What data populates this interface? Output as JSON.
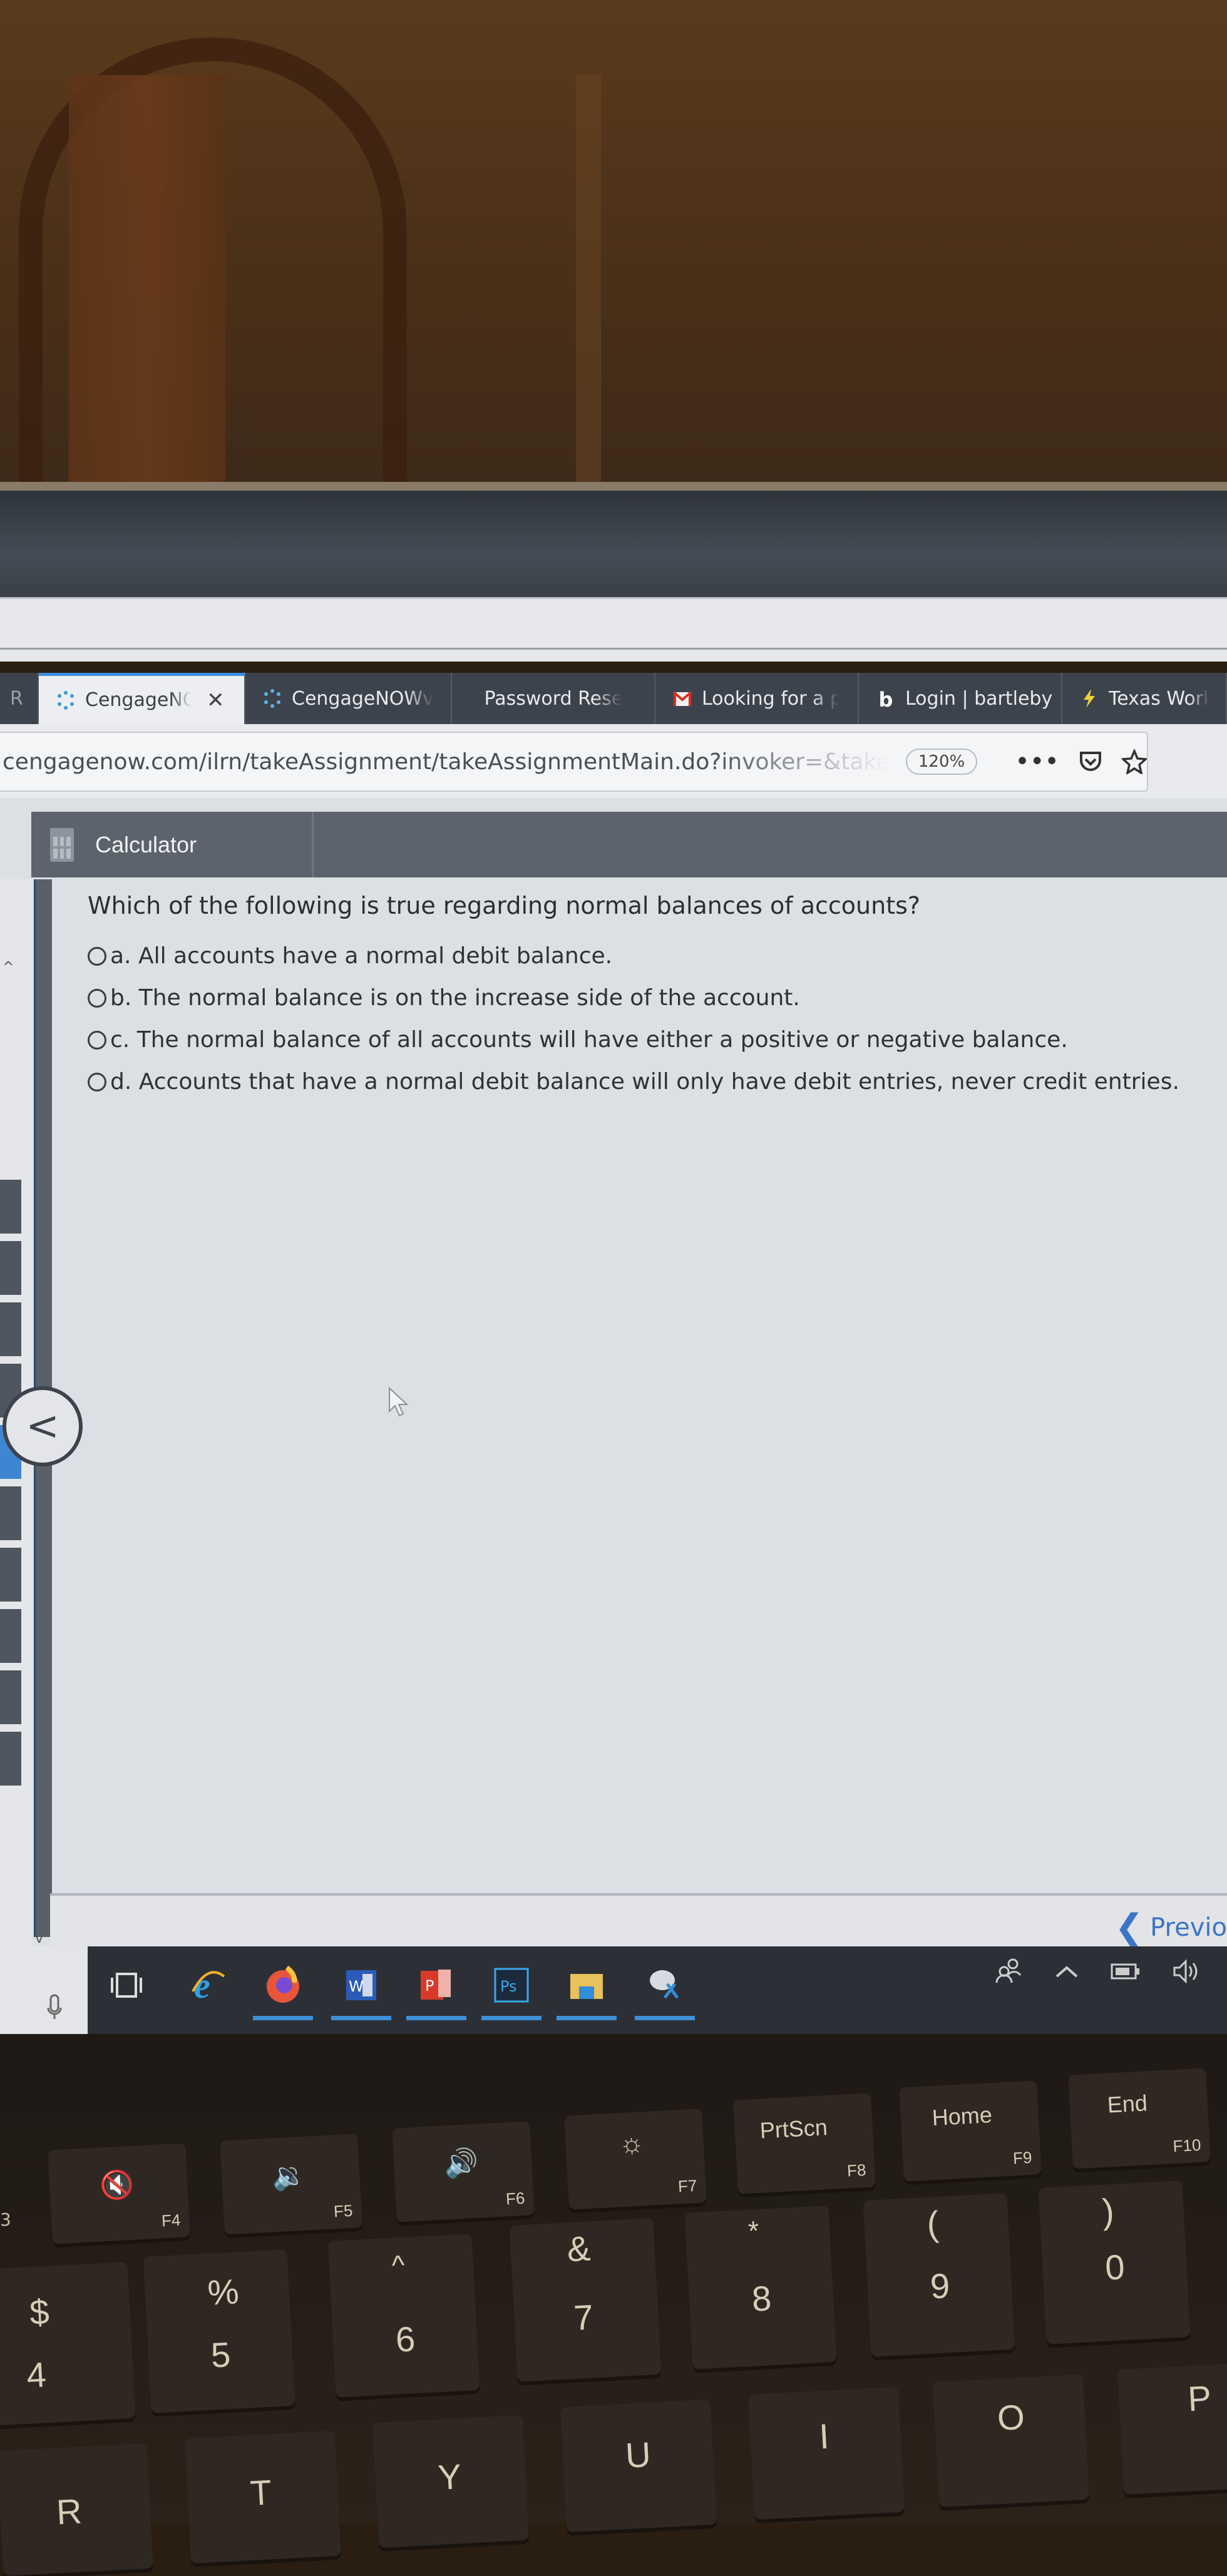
{
  "browser": {
    "tabs": [
      {
        "label": "R",
        "icon": "partial-tab",
        "active": false
      },
      {
        "label": "CengageNO",
        "icon": "cengage-icon",
        "active": true,
        "closable": true,
        "close_label": "✕"
      },
      {
        "label": "CengageNOWv",
        "icon": "cengage-icon",
        "active": false
      },
      {
        "label": "Password Reset",
        "icon": "",
        "active": false
      },
      {
        "label": "Looking for a p",
        "icon": "gmail-icon",
        "active": false
      },
      {
        "label": "Login | bartleby",
        "icon": "bartleby-icon",
        "active": false
      },
      {
        "label": "Texas Workforc",
        "icon": "lightning-icon",
        "active": false
      }
    ],
    "url": "cengagenow.com/ilrn/takeAssignment/takeAssignmentMain.do?invoker=&takeAssignmentSe",
    "zoom_level": "120%",
    "menu_label": "•••"
  },
  "toolbar": {
    "calculator_label": "Calculator"
  },
  "question": {
    "text": "Which of the following is true regarding normal balances of accounts?",
    "options": [
      {
        "letter": "a.",
        "text": "All accounts have a normal debit balance.",
        "selected": false
      },
      {
        "letter": "b.",
        "text": "The normal balance is on the increase side of the account.",
        "selected": false
      },
      {
        "letter": "c.",
        "text": "The normal balance of all accounts will have either a positive or negative balance.",
        "selected": false
      },
      {
        "letter": "d.",
        "text": "Accounts that have a normal debit balance will only have debit entries, never credit entries.",
        "selected": false
      }
    ]
  },
  "navigation": {
    "previous_label": "Previo",
    "collapse_glyph": "<"
  },
  "taskbar": {
    "apps": [
      "task-view",
      "internet-explorer",
      "firefox",
      "word",
      "powerpoint",
      "photoshop",
      "file-explorer",
      "snipping-tool"
    ],
    "ps_label": "Ps",
    "word_label": "W",
    "ppt_label": "P"
  },
  "keyboard": {
    "function_row": [
      {
        "main": "🔇",
        "sub": "F4"
      },
      {
        "main": "🔉",
        "sub": "F5"
      },
      {
        "main": "🔊",
        "sub": "F6"
      },
      {
        "main": "☼",
        "sub": "F7"
      },
      {
        "main": "PrtScn",
        "sub": "F8"
      },
      {
        "main": "Home",
        "sub": "F9"
      },
      {
        "main": "End",
        "sub": "F10"
      }
    ],
    "number_row": [
      {
        "shift": "$",
        "main": "4"
      },
      {
        "shift": "%",
        "main": "5"
      },
      {
        "shift": "^",
        "main": "6"
      },
      {
        "shift": "&",
        "main": "7"
      },
      {
        "shift": "*",
        "main": "8"
      },
      {
        "shift": "(",
        "main": "9"
      },
      {
        "shift": ")",
        "main": "0"
      }
    ],
    "letter_row": [
      "R",
      "T",
      "Y",
      "U",
      "I",
      "O",
      "P"
    ],
    "partial_left": "3"
  },
  "colors": {
    "accent_blue": "#3d74c6",
    "tab_bar": "#3d434c",
    "calc_header": "#5c636d"
  }
}
